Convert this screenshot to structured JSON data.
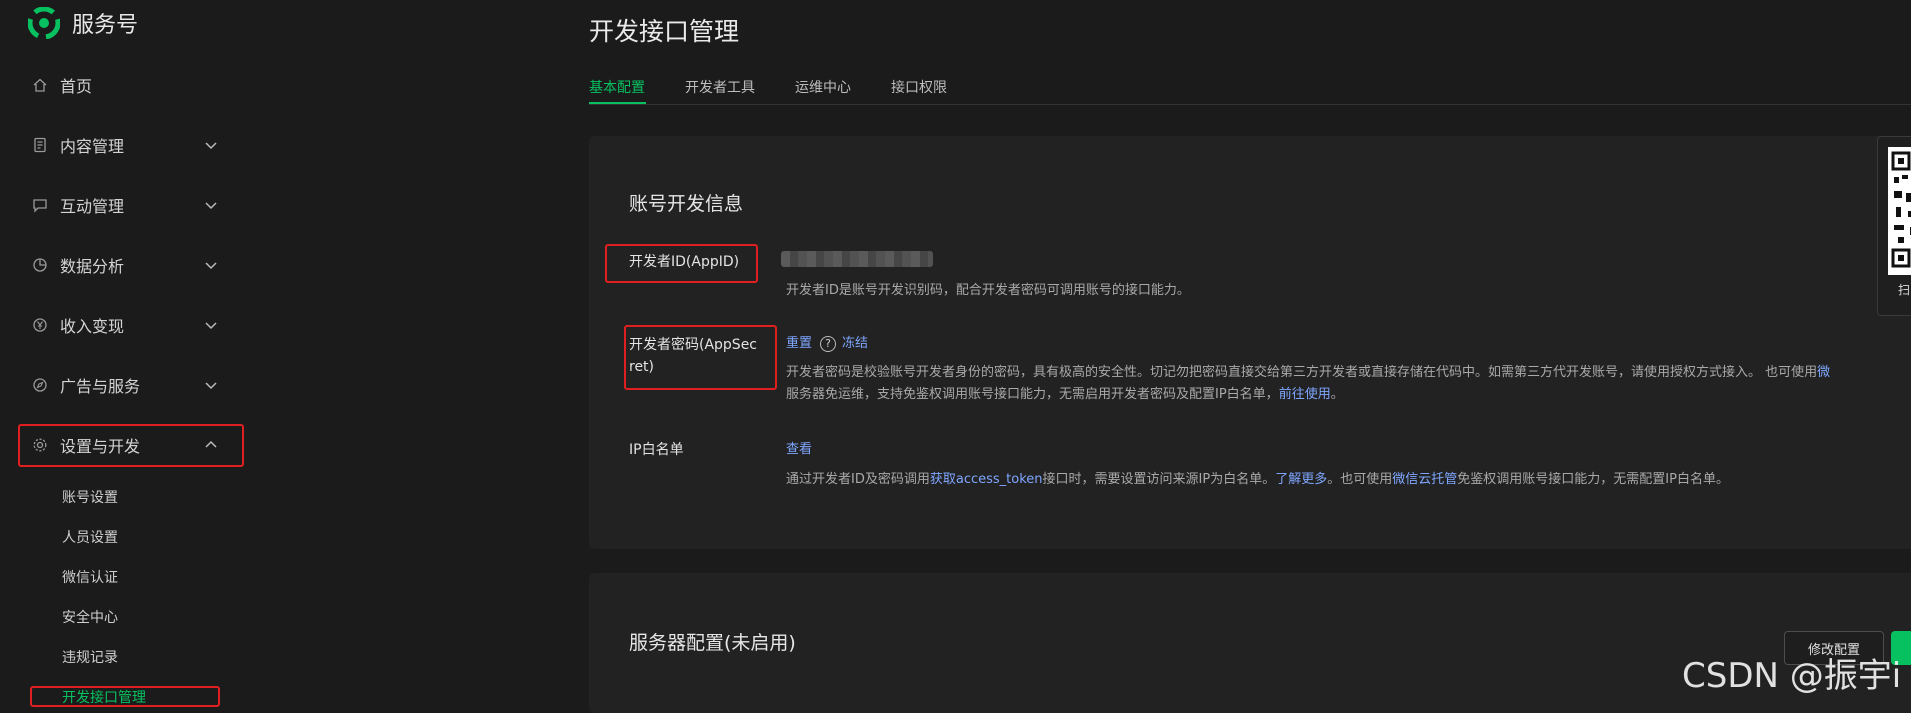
{
  "brand": {
    "name": "服务号"
  },
  "sidebar": {
    "items": [
      {
        "label": "首页",
        "icon": "home-icon"
      },
      {
        "label": "内容管理",
        "icon": "document-icon"
      },
      {
        "label": "互动管理",
        "icon": "chat-icon"
      },
      {
        "label": "数据分析",
        "icon": "pie-chart-icon"
      },
      {
        "label": "收入变现",
        "icon": "yen-icon"
      },
      {
        "label": "广告与服务",
        "icon": "compass-icon"
      },
      {
        "label": "设置与开发",
        "icon": "gear-icon"
      }
    ],
    "sub_items": [
      "账号设置",
      "人员设置",
      "微信认证",
      "安全中心",
      "违规记录",
      "开发接口管理"
    ]
  },
  "page": {
    "title": "开发接口管理",
    "tabs": [
      "基本配置",
      "开发者工具",
      "运维中心",
      "接口权限"
    ],
    "active_tab": "基本配置"
  },
  "dev_info": {
    "title": "账号开发信息",
    "appid": {
      "label": "开发者ID(AppID)",
      "desc": "开发者ID是账号开发识别码，配合开发者密码可调用账号的接口能力。"
    },
    "secret": {
      "label_line1": "开发者密码(AppSec",
      "label_line2": "ret)",
      "reset": "重置",
      "help": "?",
      "freeze": "冻结",
      "desc_line1": "开发者密码是校验账号开发者身份的密码，具有极高的安全性。切记勿把密码直接交给第三方开发者或直接存储在代码中。如需第三方代开发账号，请使用授权方式接入。  也可使用",
      "desc_line1_link": "微",
      "desc_line2": "服务器免运维，支持免鉴权调用账号接口能力，无需启用开发者密码及配置IP白名单，",
      "desc_line2_link": "前往使用",
      "desc_line2_end": "。"
    },
    "ip": {
      "label": "IP白名单",
      "view": "查看",
      "desc_a": "通过开发者ID及密码调用",
      "desc_link1": "获取access_token",
      "desc_b": "接口时，需要设置访问来源IP为白名单。",
      "desc_link2": "了解更多",
      "desc_c": "。也可使用",
      "desc_link3": "微信云托管",
      "desc_d": "免鉴权调用账号接口能力，无需配置IP白名单。"
    }
  },
  "qr_panel": {
    "text": "扫"
  },
  "server_config": {
    "title": "服务器配置(未启用)",
    "modify_button": "修改配置"
  },
  "watermark": "CSDN @振宇i",
  "colors": {
    "accent": "#07c160",
    "link": "#7fa6ff",
    "highlight_box": "#e02020"
  }
}
